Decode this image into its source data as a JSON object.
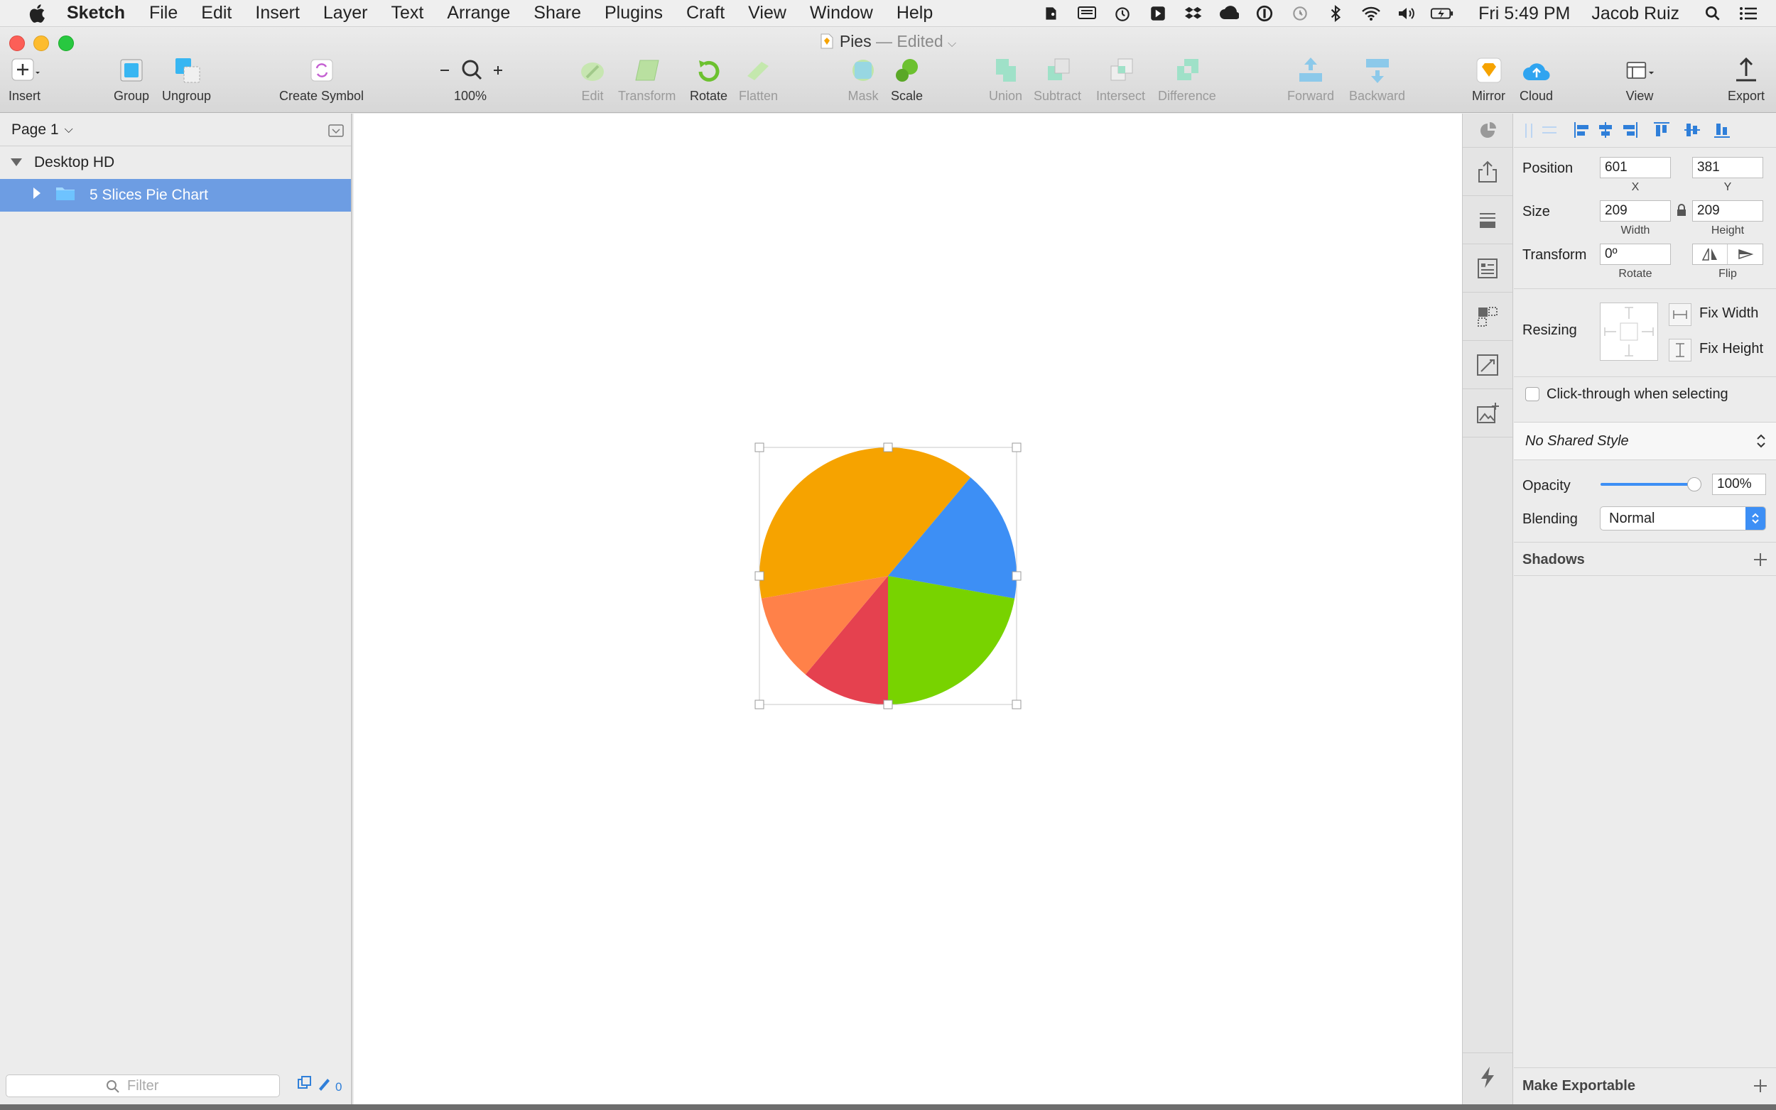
{
  "menubar": {
    "app": "Sketch",
    "items": [
      "File",
      "Edit",
      "Insert",
      "Layer",
      "Text",
      "Arrange",
      "Share",
      "Plugins",
      "Craft",
      "View",
      "Window",
      "Help"
    ],
    "clock": "Fri 5:49 PM",
    "user": "Jacob Ruiz"
  },
  "window": {
    "title": "Pies",
    "edited": "— Edited"
  },
  "toolbar": {
    "insert": "Insert",
    "group": "Group",
    "ungroup": "Ungroup",
    "create_symbol": "Create Symbol",
    "zoom": "100%",
    "edit": "Edit",
    "transform": "Transform",
    "rotate": "Rotate",
    "flatten": "Flatten",
    "mask": "Mask",
    "scale": "Scale",
    "union": "Union",
    "subtract": "Subtract",
    "intersect": "Intersect",
    "difference": "Difference",
    "forward": "Forward",
    "backward": "Backward",
    "mirror": "Mirror",
    "cloud": "Cloud",
    "view": "View",
    "export": "Export"
  },
  "layers": {
    "page": "Page 1",
    "artboard": "Desktop HD",
    "group": "5 Slices Pie Chart",
    "filter_placeholder": "Filter",
    "slice_count": "0"
  },
  "pie": {
    "slices": [
      {
        "color": "#f6a300",
        "value": 0.389
      },
      {
        "color": "#3d8ff5",
        "value": 0.167
      },
      {
        "color": "#78d300",
        "value": 0.222
      },
      {
        "color": "#e5414f",
        "value": 0.111
      },
      {
        "color": "#ff8149",
        "value": 0.111
      }
    ]
  },
  "inspector": {
    "position_label": "Position",
    "x": "601",
    "y": "381",
    "x_label": "X",
    "y_label": "Y",
    "size_label": "Size",
    "width": "209",
    "height": "209",
    "width_label": "Width",
    "height_label": "Height",
    "transform_label": "Transform",
    "rotate": "0º",
    "rotate_label": "Rotate",
    "flip_label": "Flip",
    "resizing_label": "Resizing",
    "fix_width": "Fix Width",
    "fix_height": "Fix Height",
    "click_through": "Click-through when selecting",
    "shared_style": "No Shared Style",
    "opacity_label": "Opacity",
    "opacity": "100%",
    "opacity_value": 1.0,
    "blending_label": "Blending",
    "blending": "Normal",
    "shadows_label": "Shadows",
    "make_exportable": "Make Exportable"
  }
}
